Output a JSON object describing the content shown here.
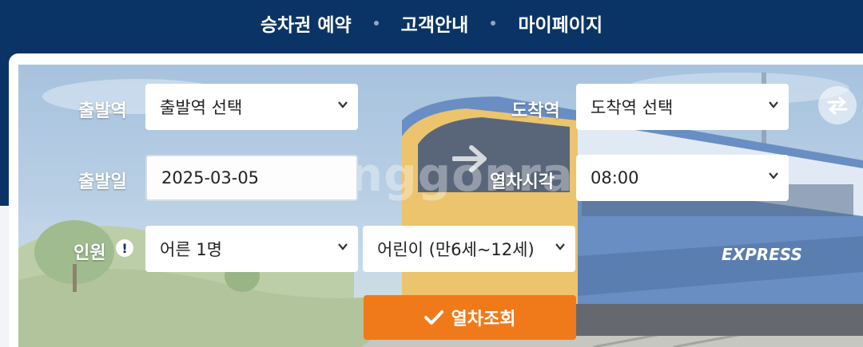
{
  "nav": {
    "items": [
      "승차권 예약",
      "고객안내",
      "마이페이지"
    ]
  },
  "scene": {
    "watermark": "bunggonra"
  },
  "form": {
    "departure_label": "출발역",
    "departure_value": "출발역 선택",
    "arrival_label": "도착역",
    "arrival_value": "도착역 선택",
    "date_label": "출발일",
    "date_value": "2025-03-05",
    "time_label": "열차시각",
    "time_value": "08:00",
    "passenger_label": "인원",
    "adult_value": "어른 1명",
    "child_value": "어린이 (만6세~12세)",
    "search_label": "열차조회"
  },
  "colors": {
    "navy": "#0b3466",
    "accent_orange": "#f07a1a"
  },
  "icons": [
    "info-icon",
    "arrow-right-icon",
    "swap-icon",
    "check-icon",
    "chevron-down-icon"
  ]
}
